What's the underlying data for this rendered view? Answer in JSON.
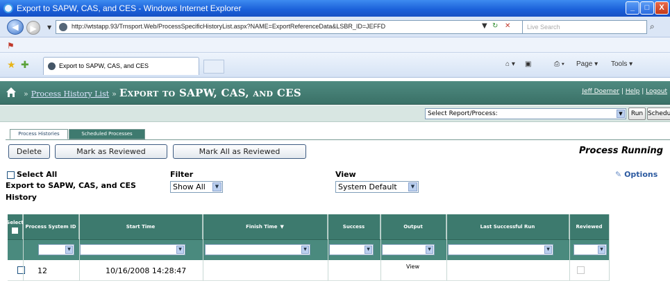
{
  "window": {
    "title": "Export to SAPW, CAS, and CES - Windows Internet Explorer",
    "min": "_",
    "max": "□",
    "close": "X"
  },
  "browser": {
    "url": "http://wtstapp.93/Trnsport.Web/ProcessSpecificHistoryList.aspx?NAME=ExportReferenceData&LSBR_ID=JEFFD",
    "search_placeholder": "Live Search",
    "tab_label": "Export to SAPW, CAS, and CES",
    "page_menu": "Page",
    "tools_menu": "Tools"
  },
  "app": {
    "breadcrumb_link": "Process History List",
    "breadcrumb_sep": "»",
    "breadcrumb_current": "Export to SAPW, CAS, and CES",
    "user": "Jeff Doerner",
    "help": "Help",
    "logout": "Logout",
    "report_select": "Select Report/Process:",
    "run": "Run",
    "schedule": "Schedule"
  },
  "tabs": {
    "process_histories": "Process Histories",
    "scheduled_processes": "Scheduled Processes"
  },
  "actions": {
    "delete": "Delete",
    "mark_reviewed": "Mark as Reviewed",
    "mark_all_reviewed": "Mark All as Reviewed",
    "status": "Process Running"
  },
  "filters": {
    "select_all": "Select All",
    "section_title_1": "Export to SAPW, CAS, and CES",
    "section_title_2": "History",
    "filter_label": "Filter",
    "filter_value": "Show All",
    "view_label": "View",
    "view_value": "System Default",
    "options": "Options"
  },
  "grid": {
    "headers": {
      "select": "Select",
      "process_id": "Process System ID",
      "start": "Start Time",
      "finish": "Finish Time",
      "success": "Success",
      "output": "Output",
      "last_run": "Last Successful Run",
      "reviewed": "Reviewed"
    },
    "rows": [
      {
        "id": "12",
        "start": "10/16/2008 14:28:47",
        "finish": "",
        "success": "",
        "output": "View",
        "last_run": ""
      }
    ]
  },
  "colors": {
    "header_green": "#3d7a6e",
    "app_bar": "#4f8a80",
    "ie_blue": "#1a5fd8"
  }
}
